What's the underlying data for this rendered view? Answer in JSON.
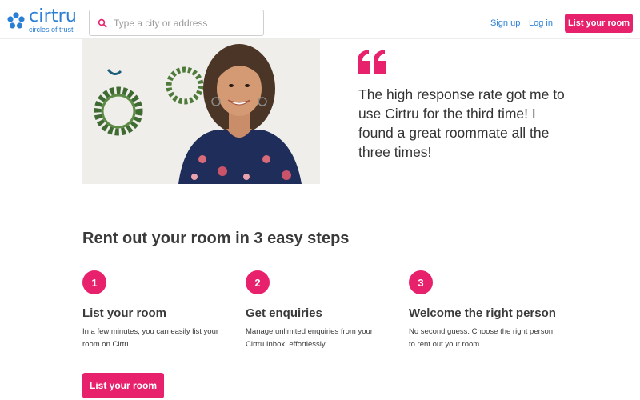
{
  "brand": {
    "name": "cirtru",
    "tagline": "circles of trust",
    "color": "#2a7fd4"
  },
  "accent_color": "#e8216c",
  "header": {
    "search_placeholder": "Type a city or address",
    "signup_label": "Sign up",
    "login_label": "Log in",
    "cta_label": "List your room"
  },
  "testimonial": {
    "quote": "The high response rate got me to use Cirtru for the third time! I found a great roommate all the three times!"
  },
  "steps_section": {
    "title": "Rent out your room in 3 easy steps",
    "steps": [
      {
        "number": "1",
        "title": "List your room",
        "description": "In a few minutes, you can easily list your room on Cirtru."
      },
      {
        "number": "2",
        "title": "Get enquiries",
        "description": "Manage unlimited enquiries from your Cirtru Inbox, effortlessly."
      },
      {
        "number": "3",
        "title": "Welcome the right person",
        "description": "No second guess. Choose the right person to rent out your room."
      }
    ],
    "cta_label": "List your room"
  }
}
